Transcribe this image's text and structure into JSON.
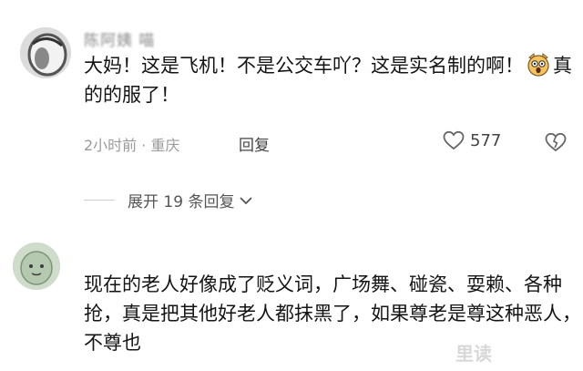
{
  "comment1": {
    "username": "陈阿姨 喵",
    "text_before_emoji": "大妈！这是飞机！不是公交车吖？这是实名制的啊！",
    "text_after_emoji": "真的的服了！",
    "meta": "2小时前 · 重庆",
    "reply_label": "回复",
    "likes": "577"
  },
  "expand": {
    "label": "展开 19 条回复"
  },
  "comment2": {
    "text": "现在的老人好像成了贬义词，广场舞、碰瓷、耍赖、各种抢，真是把其他好老人都抹黑了，如果尊老是尊这种恶人，不尊也"
  },
  "watermark": {
    "text": "里读"
  },
  "colors": {
    "text": "#141414",
    "meta": "#9a9a9a",
    "icon": "#666666"
  }
}
